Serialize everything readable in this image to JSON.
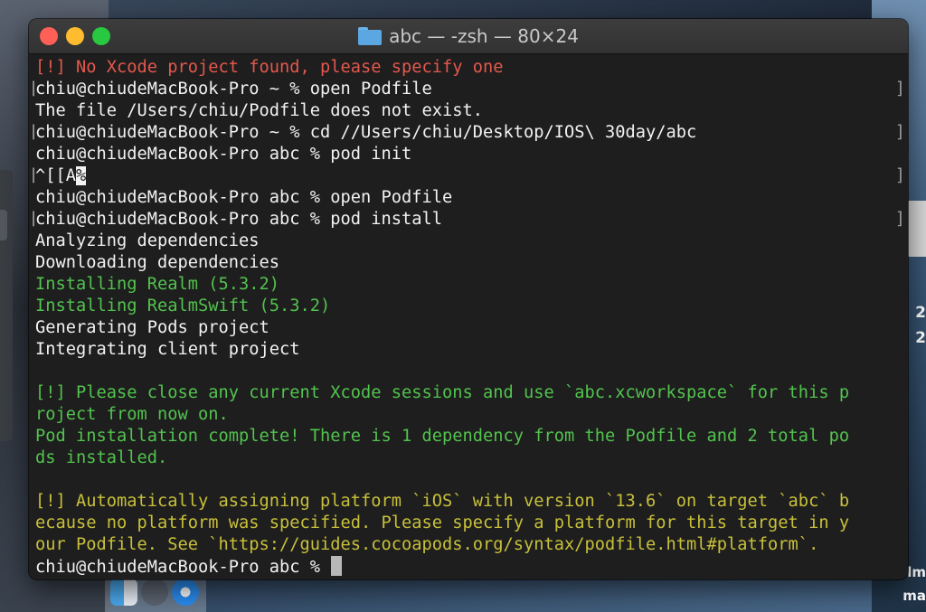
{
  "window": {
    "title": "abc — -zsh — 80×24"
  },
  "desktop": {
    "right_labels": [
      "2",
      "2",
      "lm",
      "ma"
    ]
  },
  "terminal": {
    "lines": [
      {
        "text": "[!] No Xcode project found, please specify one",
        "color": "red",
        "bracketed": false
      },
      {
        "text": "chiu@chiudeMacBook-Pro ~ % open Podfile",
        "color": "white",
        "bracketed": true
      },
      {
        "text": "The file /Users/chiu/Podfile does not exist.",
        "color": "white",
        "bracketed": false
      },
      {
        "text": "chiu@chiudeMacBook-Pro ~ % cd //Users/chiu/Desktop/IOS\\ 30day/abc",
        "color": "white",
        "bracketed": true
      },
      {
        "text": "chiu@chiudeMacBook-Pro abc % pod init",
        "color": "white",
        "bracketed": false
      },
      {
        "text": "^[[A",
        "suffix": "%",
        "color": "white",
        "bracketed": true
      },
      {
        "text": "chiu@chiudeMacBook-Pro abc % open Podfile",
        "color": "white",
        "bracketed": false
      },
      {
        "text": "chiu@chiudeMacBook-Pro abc % pod install",
        "color": "white",
        "bracketed": true
      },
      {
        "text": "Analyzing dependencies",
        "color": "white",
        "bracketed": false
      },
      {
        "text": "Downloading dependencies",
        "color": "white",
        "bracketed": false
      },
      {
        "text": "Installing Realm (5.3.2)",
        "color": "green",
        "bracketed": false
      },
      {
        "text": "Installing RealmSwift (5.3.2)",
        "color": "green",
        "bracketed": false
      },
      {
        "text": "Generating Pods project",
        "color": "white",
        "bracketed": false
      },
      {
        "text": "Integrating client project",
        "color": "white",
        "bracketed": false
      },
      {
        "text": "",
        "color": "white",
        "bracketed": false
      },
      {
        "text": "[!] Please close any current Xcode sessions and use `abc.xcworkspace` for this p",
        "color": "green",
        "bracketed": false
      },
      {
        "text": "roject from now on.",
        "color": "green",
        "bracketed": false
      },
      {
        "text": "Pod installation complete! There is 1 dependency from the Podfile and 2 total po",
        "color": "green",
        "bracketed": false
      },
      {
        "text": "ds installed.",
        "color": "green",
        "bracketed": false
      },
      {
        "text": "",
        "color": "white",
        "bracketed": false
      },
      {
        "text": "[!] Automatically assigning platform `iOS` with version `13.6` on target `abc` b",
        "color": "yellow",
        "bracketed": false
      },
      {
        "text": "ecause no platform was specified. Please specify a platform for this target in y",
        "color": "yellow",
        "bracketed": false
      },
      {
        "text": "our Podfile. See `https://guides.cocoapods.org/syntax/podfile.html#platform`.",
        "color": "yellow",
        "bracketed": false
      },
      {
        "text": "chiu@chiudeMacBook-Pro abc % ",
        "color": "white",
        "bracketed": false,
        "cursor": true
      }
    ],
    "bracket_left": "[",
    "bracket_right": "]"
  },
  "colors": {
    "red": "#e4584d",
    "green": "#52c34e",
    "yellow": "#c8c03a",
    "white": "#f2f2f2",
    "background": "#1e1e1e"
  },
  "icons": {
    "close": "close-button-icon",
    "minimize": "minimize-button-icon",
    "zoom": "zoom-button-icon",
    "folder": "folder-icon"
  }
}
